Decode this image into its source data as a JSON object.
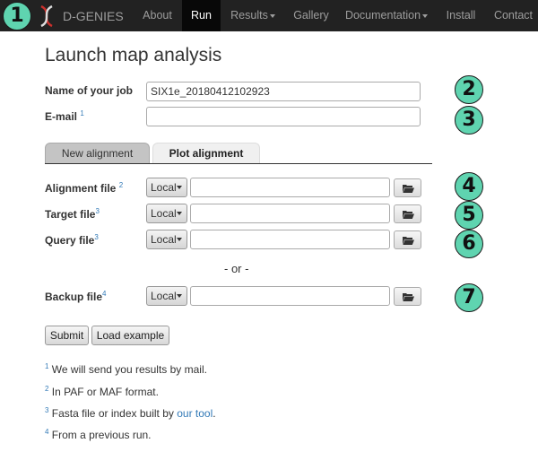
{
  "navbar": {
    "brand": "D-GENIES",
    "items": [
      "About",
      "Run",
      "Results",
      "Gallery",
      "Documentation",
      "Install",
      "Contact"
    ],
    "active": "Run"
  },
  "page_title": "Launch map analysis",
  "form": {
    "job_label": "Name of your job",
    "job_value": "SIX1e_20180412102923",
    "email_label": "E-mail",
    "email_note_ref": "1",
    "email_value": ""
  },
  "tabs": {
    "new": "New alignment",
    "plot": "Plot alignment",
    "active": "Plot alignment"
  },
  "files": {
    "alignment_label": "Alignment file",
    "alignment_ref": "2",
    "target_label": "Target file",
    "target_ref": "3",
    "query_label": "Query file",
    "query_ref": "3",
    "backup_label": "Backup file",
    "backup_ref": "4",
    "source_option": "Local",
    "or_text": "- or -"
  },
  "buttons": {
    "submit": "Submit",
    "load_example": "Load example"
  },
  "footnotes": {
    "n1_ref": "1",
    "n1": "We will send you results by mail.",
    "n2_ref": "2",
    "n2": "In PAF or MAF format.",
    "n3_ref": "3",
    "n3_text": "Fasta file or index built by",
    "n3_link": "our tool",
    "n3_end": ".",
    "n4_ref": "4",
    "n4": "From a previous run."
  },
  "callouts": [
    "1",
    "2",
    "3",
    "4",
    "5",
    "6",
    "7"
  ],
  "colors": {
    "navbar": "#222222",
    "callout": "#5fd4b0",
    "link": "#337ab7"
  }
}
